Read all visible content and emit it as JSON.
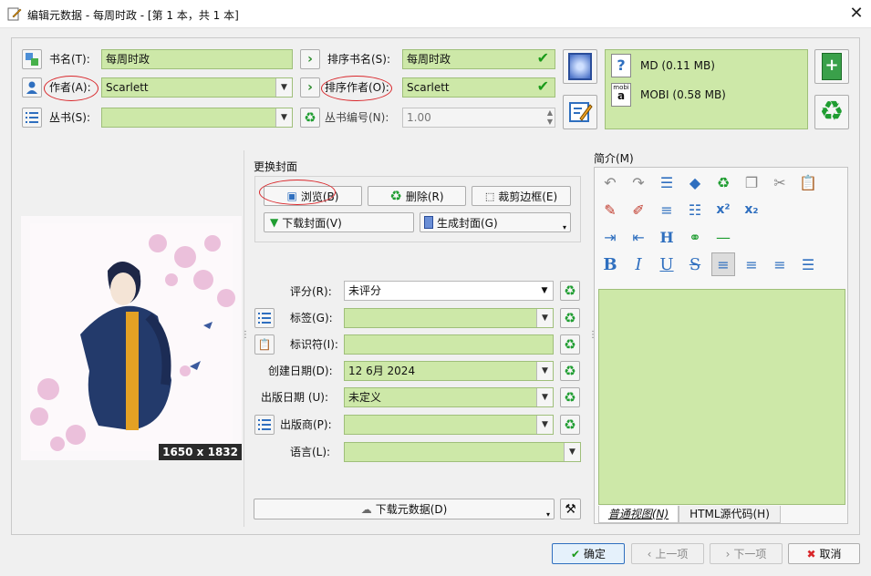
{
  "window": {
    "title": "编辑元数据 - 每周时政 - [第 1 本，共 1 本]"
  },
  "fields": {
    "title_label": "书名(T):",
    "title_value": "每周时政",
    "author_label": "作者(A):",
    "author_value": "Scarlett",
    "series_label": "丛书(S):",
    "series_value": "",
    "sort_title_label": "排序书名(S):",
    "sort_title_value": "每周时政",
    "sort_author_label": "排序作者(O):",
    "sort_author_value": "Scarlett",
    "series_index_label": "丛书编号(N):",
    "series_index_value": "1.00"
  },
  "formats": [
    {
      "name": "MD (0.11 MB)",
      "icon": "unknown-file-icon"
    },
    {
      "name": "MOBI (0.58 MB)",
      "icon": "mobi-file-icon"
    }
  ],
  "cover": {
    "dimensions": "1650 x 1832",
    "section_title": "更换封面",
    "browse": "浏览(B)",
    "remove": "删除(R)",
    "trim": "裁剪边框(E)",
    "download": "下载封面(V)",
    "generate": "生成封面(G)"
  },
  "meta": {
    "rating_label": "评分(R):",
    "rating_value": "未评分",
    "tags_label": "标签(G):",
    "tags_value": "",
    "ids_label": "标识符(I):",
    "ids_value": "",
    "date_label": "创建日期(D):",
    "date_value": "12 6月 2024",
    "pubdate_label": "出版日期 (U):",
    "pubdate_value": "未定义",
    "publisher_label": "出版商(P):",
    "publisher_value": "",
    "language_label": "语言(L):",
    "language_value": "",
    "download_metadata": "下载元数据(D)"
  },
  "comments": {
    "label": "简介(M)",
    "tab_normal": "普通视图(N)",
    "tab_html": "HTML源代码(H)"
  },
  "footer": {
    "ok": "确定",
    "prev": "上一项",
    "next": "下一项",
    "cancel": "取消"
  },
  "colors": {
    "field_green": "#cde8a8",
    "accent_blue": "#2f6fbf",
    "recycle_green": "#1f9d31",
    "annotation_red": "#d9262a"
  }
}
